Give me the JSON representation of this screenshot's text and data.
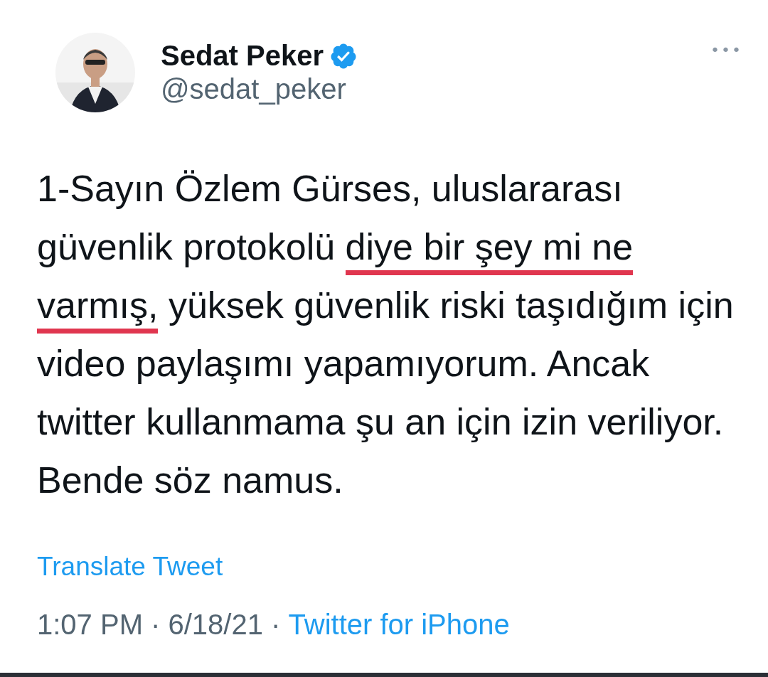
{
  "author": {
    "name": "Sedat Peker",
    "verified": true,
    "handle": "@sedat_peker"
  },
  "more_menu": "•••",
  "tweet": {
    "segments": [
      {
        "text": "1-Sayın Özlem Gürses, uluslararası güvenlik protokolü ",
        "marked": false
      },
      {
        "text": "diye bir şey mi ne varmış,",
        "marked": true
      },
      {
        "text": " yüksek güvenlik riski taşıdığım için video paylaşımı yapamıyorum. Ancak twitter kullanmama şu an için izin veriliyor. Bende söz namus.",
        "marked": false
      }
    ]
  },
  "translate_link": "Translate Tweet",
  "meta": {
    "timestamp": "1:07 PM · 6/18/21 · ",
    "source": "Twitter for iPhone"
  }
}
